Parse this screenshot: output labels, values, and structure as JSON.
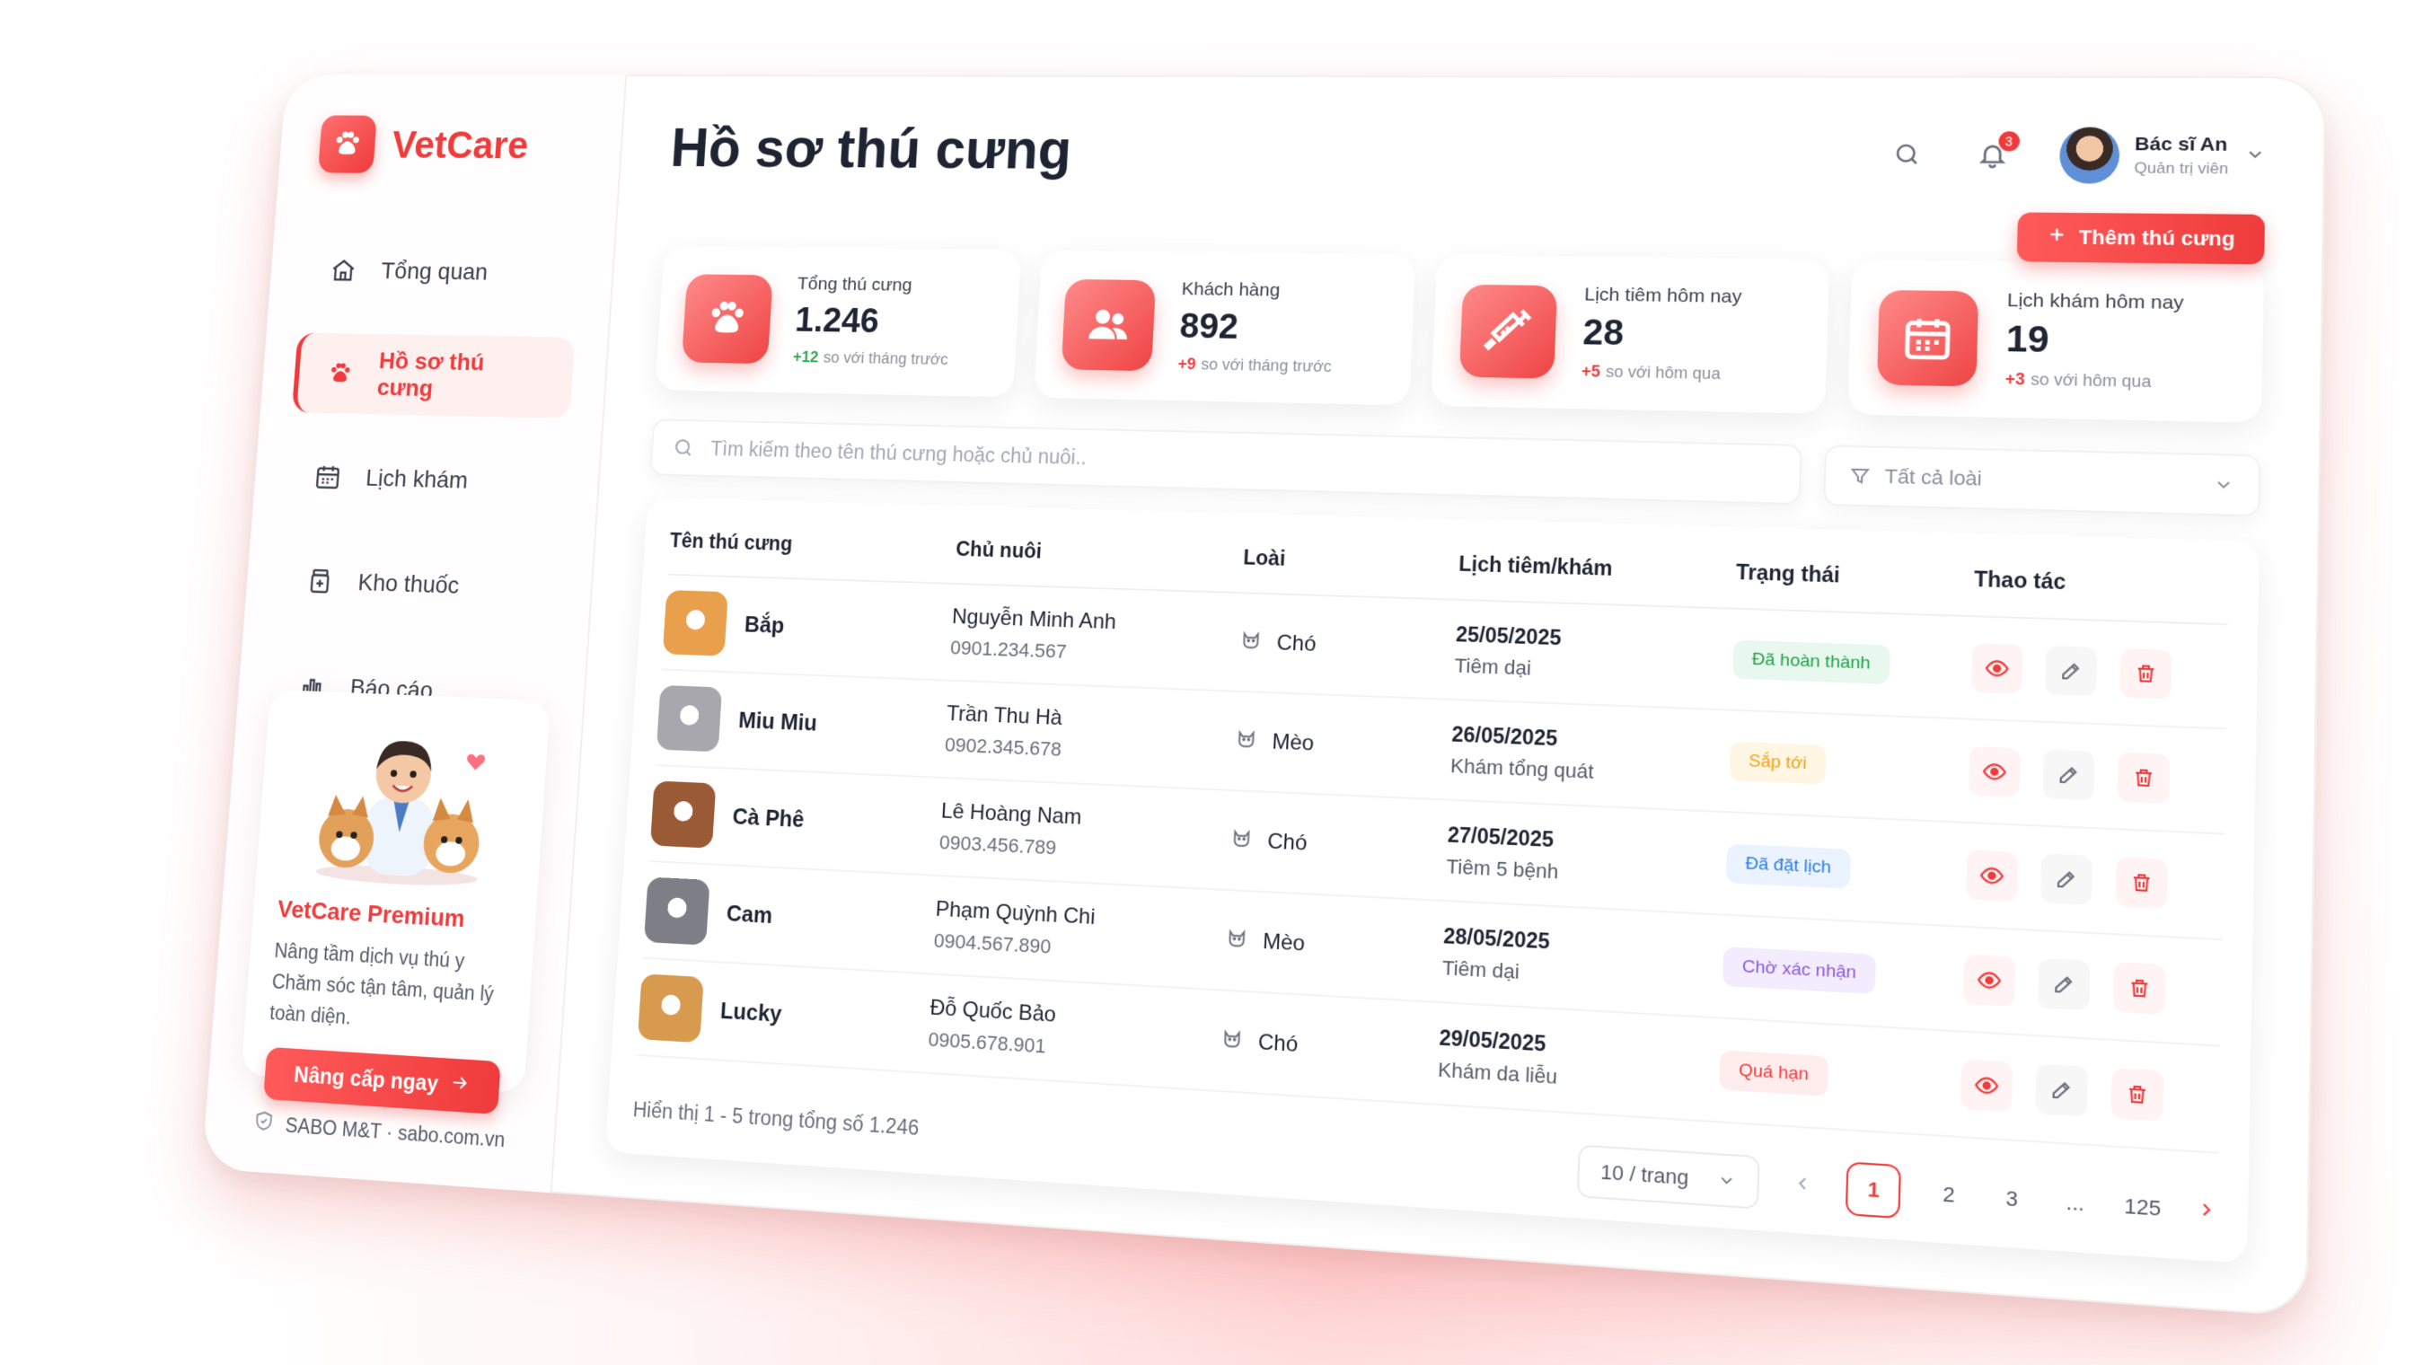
{
  "app": {
    "name": "VetCare"
  },
  "sidebar": {
    "items": [
      {
        "label": "Tổng quan",
        "icon": "home-icon"
      },
      {
        "label": "Hồ sơ thú cưng",
        "icon": "paw-icon",
        "active": true
      },
      {
        "label": "Lịch khám",
        "icon": "calendar-icon"
      },
      {
        "label": "Kho thuốc",
        "icon": "medicine-jar-icon"
      },
      {
        "label": "Báo cáo",
        "icon": "bar-chart-icon"
      }
    ],
    "promo": {
      "title": "VetCare Premium",
      "text": "Nâng tầm dịch vụ thú y\nChăm sóc tận tâm, quản lý\ntoàn diện.",
      "button": "Nâng cấp ngay"
    },
    "footer": "SABO M&T · sabo.com.vn"
  },
  "header": {
    "title": "Hồ sơ thú cưng",
    "notifications": "3",
    "user": {
      "name": "Bác sĩ An",
      "role": "Quản trị viên"
    },
    "add_button": "Thêm thú cưng"
  },
  "stats": [
    {
      "label": "Tổng thú cưng",
      "value": "1.246",
      "delta": "+12",
      "delta_text": "so với tháng trước",
      "delta_color": "#2eaa52",
      "icon": "paw-icon"
    },
    {
      "label": "Khách hàng",
      "value": "892",
      "delta": "+9",
      "delta_text": "so với tháng trước",
      "delta_color": "#ef3b3b",
      "icon": "users-icon"
    },
    {
      "label": "Lịch tiêm hôm nay",
      "value": "28",
      "delta": "+5",
      "delta_text": "so với hôm qua",
      "delta_color": "#ef3b3b",
      "icon": "syringe-icon"
    },
    {
      "label": "Lịch khám hôm nay",
      "value": "19",
      "delta": "+3",
      "delta_text": "so với hôm qua",
      "delta_color": "#ef3b3b",
      "icon": "calendar-icon"
    }
  ],
  "search": {
    "placeholder": "Tìm kiếm theo tên thú cưng hoặc chủ nuôi.."
  },
  "filter": {
    "value": "Tất cả loài"
  },
  "table": {
    "headers": [
      "Tên thú cưng",
      "Chủ nuôi",
      "Loài",
      "Lịch tiêm/khám",
      "Trạng thái",
      "Thao tác"
    ],
    "rows": [
      {
        "pet": "Bắp",
        "owner": "Nguyễn Minh Anh",
        "phone": "0901.234.567",
        "species": "Chó",
        "date": "25/05/2025",
        "visit": "Tiêm dại",
        "status": "Đã hoàn thành",
        "status_color": "#22a04b",
        "status_bg": "#e9f8ee",
        "photo": "#e9a04c"
      },
      {
        "pet": "Miu Miu",
        "owner": "Trần Thu Hà",
        "phone": "0902.345.678",
        "species": "Mèo",
        "date": "26/05/2025",
        "visit": "Khám tổng quát",
        "status": "Sắp tới",
        "status_color": "#f0a21a",
        "status_bg": "#fff6e3",
        "photo": "#a7a7ad"
      },
      {
        "pet": "Cà Phê",
        "owner": "Lê Hoàng Nam",
        "phone": "0903.456.789",
        "species": "Chó",
        "date": "27/05/2025",
        "visit": "Tiêm 5 bệnh",
        "status": "Đã đặt lịch",
        "status_color": "#2f7de0",
        "status_bg": "#eaf3ff",
        "photo": "#9b5a36"
      },
      {
        "pet": "Cam",
        "owner": "Phạm Quỳnh Chi",
        "phone": "0904.567.890",
        "species": "Mèo",
        "date": "28/05/2025",
        "visit": "Tiêm dại",
        "status": "Chờ xác nhận",
        "status_color": "#8a5ad8",
        "status_bg": "#f3ecff",
        "photo": "#7e7f86"
      },
      {
        "pet": "Lucky",
        "owner": "Đỗ Quốc Bảo",
        "phone": "0905.678.901",
        "species": "Chó",
        "date": "29/05/2025",
        "visit": "Khám da liễu",
        "status": "Quá hạn",
        "status_color": "#ef3b3b",
        "status_bg": "#ffecec",
        "photo": "#d89a4e"
      }
    ]
  },
  "pagination": {
    "info": "Hiển thị 1 - 5 trong tổng số 1.246",
    "per_page": "10 / trang",
    "pages": [
      "1",
      "2",
      "3",
      "...",
      "125"
    ],
    "current": "1"
  },
  "colors": {
    "accent": "#ef3b3b"
  }
}
